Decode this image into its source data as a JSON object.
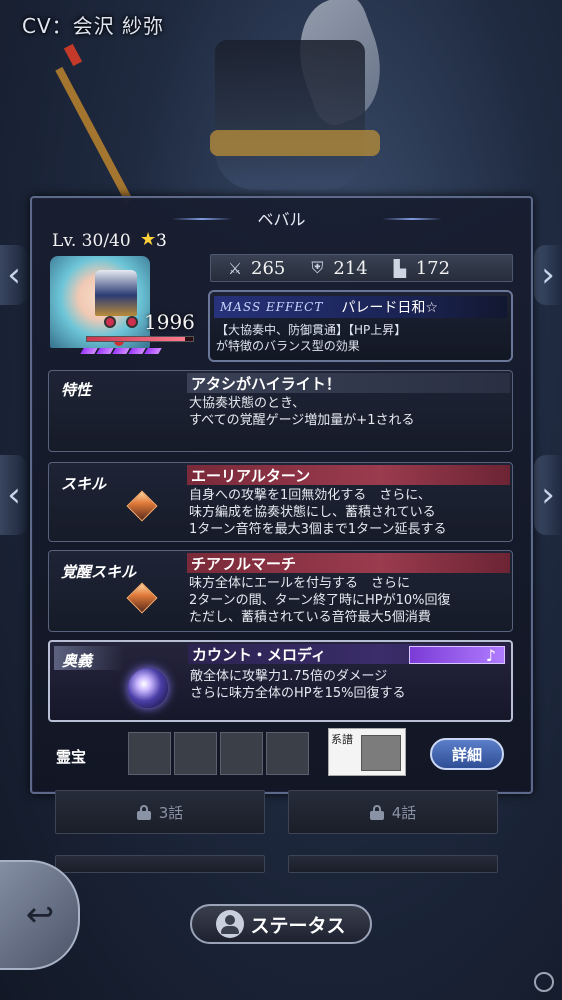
{
  "header": {
    "cv": "CV：会沢 紗弥"
  },
  "character": {
    "name": "ベバル",
    "level": "Lv. 30/40",
    "stars": "3",
    "power": "1996",
    "hp_fraction": 0.92,
    "gauge_pips": 5
  },
  "stats": {
    "attack": "265",
    "defense": "214",
    "speed": "172"
  },
  "mass_effect": {
    "label": "MASS EFFECT",
    "name": "パレード日和☆",
    "desc_line1": "【大協奏中、防御貫通】【HP上昇】",
    "desc_line2": "が特徴のバランス型の効果"
  },
  "trait": {
    "label": "特性",
    "name": "アタシがハイライト！",
    "desc_line1": "大協奏状態のとき、",
    "desc_line2": "すべての覚醒ゲージ増加量が+1される"
  },
  "skill": {
    "label": "スキル",
    "name": "エーリアルターン",
    "desc_line1": "自身への攻撃を1回無効化する　さらに、",
    "desc_line2": "味方編成を協奏状態にし、蓄積されている",
    "desc_line3": "1ターン音符を最大3個まで1ターン延長する"
  },
  "awaken": {
    "label": "覚醒スキル",
    "name": "チアフルマーチ",
    "desc_line1": "味方全体にエールを付与する　さらに",
    "desc_line2": "2ターンの間、ターン終了時にHPが10%回復",
    "desc_line3": "ただし、蓄積されている音符最大5個消費"
  },
  "ougi": {
    "label": "奥義",
    "name": "カウント・メロディ",
    "note": "♪",
    "desc_line1": "敵全体に攻撃力1.75倍のダメージ",
    "desc_line2": "さらに味方全体のHPを15%回復する"
  },
  "treasure": {
    "label": "霊宝",
    "lineage_label": "系譜",
    "detail_button": "詳細"
  },
  "chapters": {
    "ch3": "3話",
    "ch4": "4話"
  },
  "footer": {
    "status_button": "ステータス",
    "back_symbol": "↩"
  },
  "icons": {
    "attack": "sword-icon",
    "defense": "shield-icon",
    "speed": "boot-icon"
  }
}
